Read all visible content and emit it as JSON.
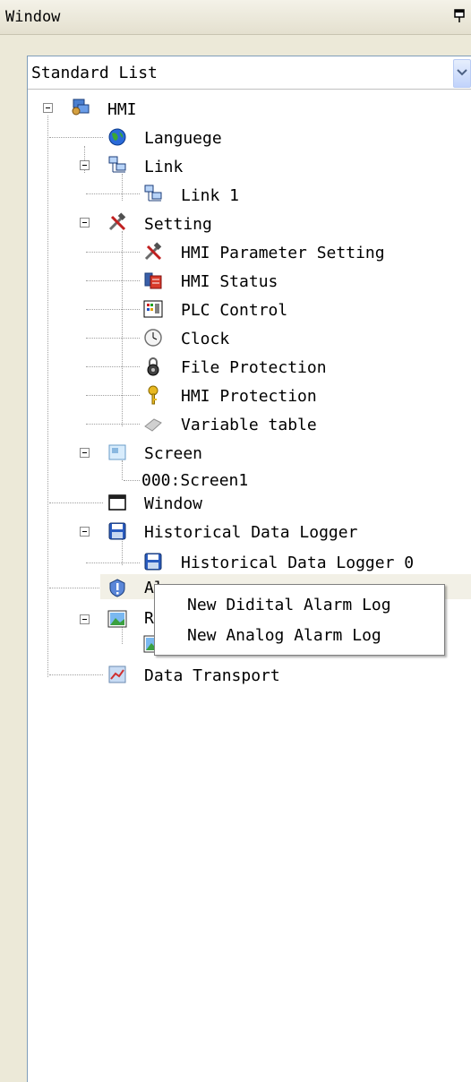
{
  "window": {
    "title": "Window"
  },
  "view_selector": {
    "value": "Standard List"
  },
  "tree": {
    "hmi": "HMI",
    "language": "Languege",
    "link": "Link",
    "link1": "Link 1",
    "setting": "Setting",
    "hmi_param": "HMI Parameter Setting",
    "hmi_status": "HMI Status",
    "plc_control": "PLC Control",
    "clock": "Clock",
    "file_protection": "File Protection",
    "hmi_protection": "HMI Protection",
    "variable_table": "Variable table",
    "screen": "Screen",
    "screen1": "000:Screen1",
    "window": "Window",
    "hdl": "Historical Data Logger",
    "hdl0": "Historical Data Logger 0",
    "alarm_partial": "Al",
    "recipe_partial": "R",
    "data_transport": "Data Transport"
  },
  "context_menu": {
    "items": [
      "New Didital Alarm Log",
      "New Analog Alarm Log"
    ]
  },
  "icons": {
    "pin": "pin-icon",
    "combo_arrow": "chevron-down-icon",
    "hmi": "hmi-icon",
    "language": "globe-icon",
    "link": "network-icon",
    "setting": "tools-icon",
    "status": "status-icon",
    "plc": "plc-control-icon",
    "clock": "clock-icon",
    "file_protection": "lock-icon",
    "hmi_protection": "key-icon",
    "variable_table": "table-icon",
    "screen": "screen-icon",
    "window": "window-icon",
    "logger": "floppy-disk-icon",
    "alarm": "shield-alert-icon",
    "recipe": "picture-icon",
    "transport": "data-transport-icon"
  },
  "colors": {
    "panel_bg": "#ece9d8",
    "tree_bg": "#ffffff",
    "highlight": "#f2f0e6",
    "menu_border": "#808080"
  }
}
